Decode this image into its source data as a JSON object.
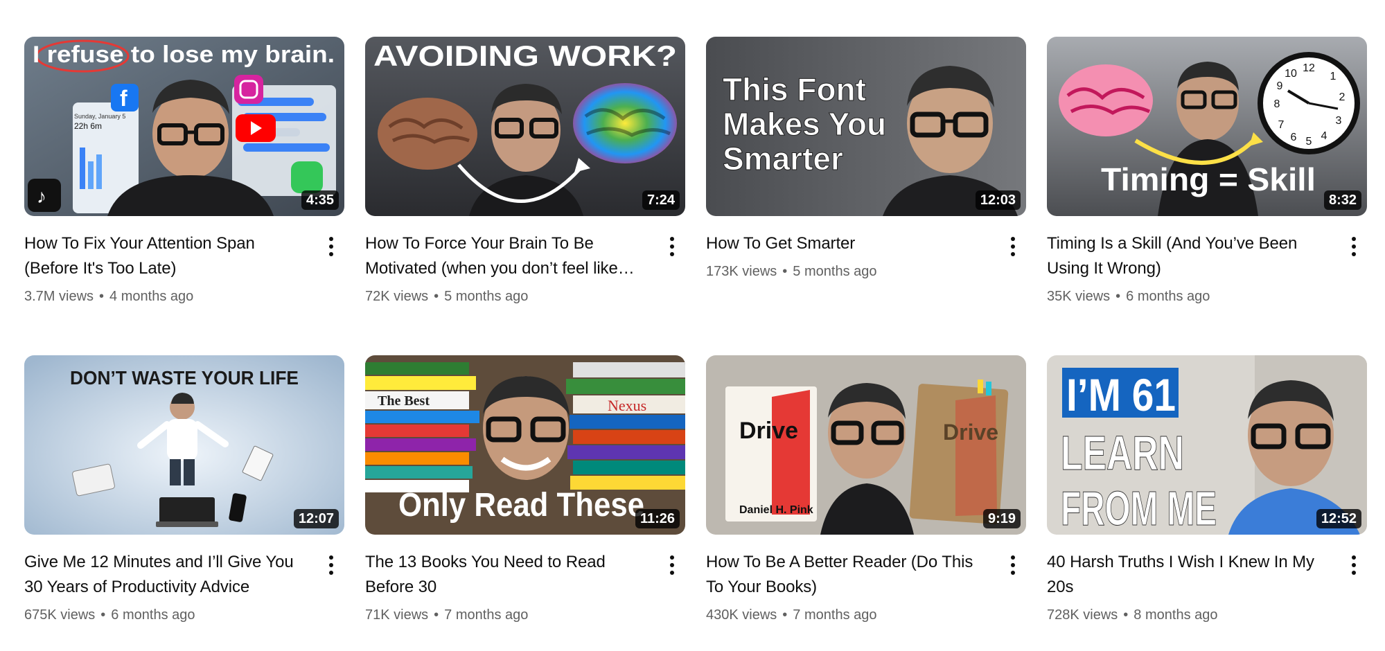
{
  "videos": [
    {
      "title": "How To Fix Your Attention Span (Before It's Too Late)",
      "views": "3.7M views",
      "age": "4 months ago",
      "duration": "4:35",
      "thumb_text": [
        "I refuse to lose my brain."
      ],
      "thumb_inner": [
        "22h 6m",
        "Sunday, January 5"
      ],
      "bg": "#5d6a78"
    },
    {
      "title": "How To Force Your Brain To Be Motivated (when you don’t feel like…",
      "views": "72K views",
      "age": "5 months ago",
      "duration": "7:24",
      "thumb_text": [
        "AVOIDING WORK?"
      ],
      "bg": "#3d3f44"
    },
    {
      "title": "How To Get Smarter",
      "views": "173K views",
      "age": "5 months ago",
      "duration": "12:03",
      "thumb_text": [
        "This Font",
        "Makes You",
        "Smarter"
      ],
      "bg": "#5a5c60"
    },
    {
      "title": "Timing Is a Skill (And You’ve Been Using It Wrong)",
      "views": "35K views",
      "age": "6 months ago",
      "duration": "8:32",
      "thumb_text": [
        "Timing = Skill"
      ],
      "bg": "#8a8d92"
    },
    {
      "title": "Give Me 12 Minutes and I’ll Give You 30 Years of Productivity Advice",
      "views": "675K views",
      "age": "6 months ago",
      "duration": "12:07",
      "thumb_text": [
        "DON’T WASTE YOUR LIFE"
      ],
      "bg": "#bcd0e2"
    },
    {
      "title": "The 13 Books You Need to Read Before 30",
      "views": "71K views",
      "age": "7 months ago",
      "duration": "11:26",
      "thumb_text": [
        "Only Read These"
      ],
      "thumb_inner": [
        "Nexus",
        "The Best"
      ],
      "bg": "#6b5a48"
    },
    {
      "title": "How To Be A Better Reader (Do This To Your Books)",
      "views": "430K views",
      "age": "7 months ago",
      "duration": "9:19",
      "thumb_text": [
        "Drive",
        "Daniel H. Pink"
      ],
      "bg": "#b9b4ac"
    },
    {
      "title": "40 Harsh Truths I Wish I Knew In My 20s",
      "views": "728K views",
      "age": "8 months ago",
      "duration": "12:52",
      "thumb_text": [
        "I’M 61",
        "LEARN",
        "FROM ME"
      ],
      "bg": "#d6d3cd"
    }
  ],
  "icons": {
    "menu": "more-vert-icon",
    "brain": "brain-icon",
    "clock": "clock-icon",
    "laptop": "laptop-icon",
    "phone": "phone-icon"
  },
  "colors": {
    "title": "#0f0f0f",
    "meta": "#606060",
    "duration_bg": "#000000",
    "accent_blue": "#1565c0",
    "accent_red": "#e53935"
  }
}
